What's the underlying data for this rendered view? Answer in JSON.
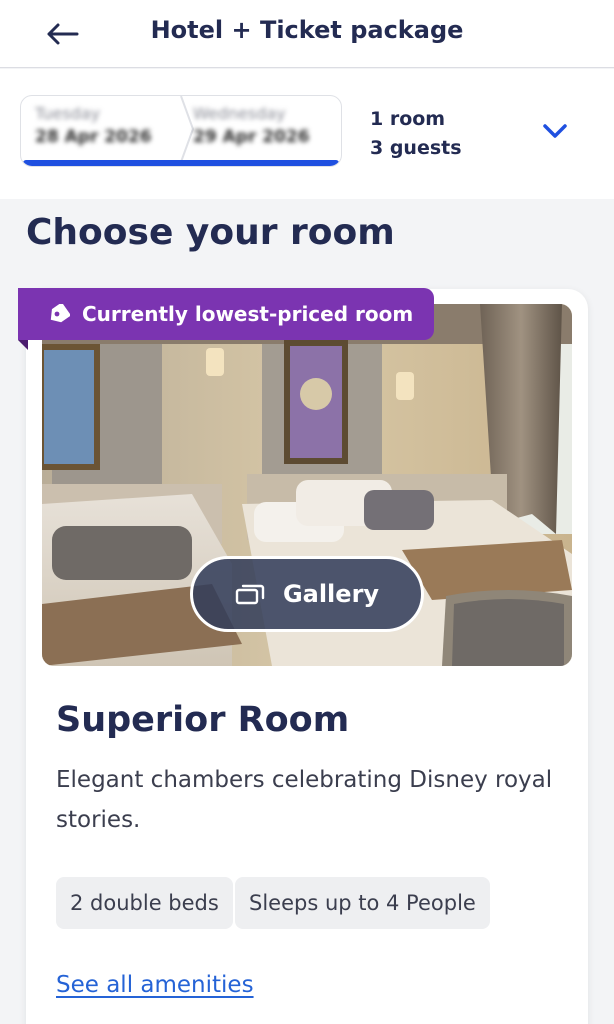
{
  "header": {
    "title": "Hotel + Ticket package",
    "back_icon": "arrow-left-icon"
  },
  "booking": {
    "checkin_day": "Tuesday",
    "checkin_date": "28 Apr 2026",
    "checkout_day": "Wednesday",
    "checkout_date": "29 Apr 2026",
    "rooms": "1 room",
    "guests": "3 guests",
    "expand_icon": "chevron-down-icon"
  },
  "section_title": "Choose your room",
  "room": {
    "badge": "Currently lowest-priced room",
    "badge_icon": "tag-icon",
    "gallery_label": "Gallery",
    "gallery_icon": "gallery-icon",
    "name": "Superior Room",
    "description": "Elegant chambers celebrating Disney royal stories.",
    "features": [
      "2 double beds",
      "Sleeps up to 4 People"
    ],
    "amenities_link": "See all amenities"
  },
  "colors": {
    "brand_navy": "#232b52",
    "accent_blue": "#1f50e0",
    "badge_purple": "#7b34b1",
    "link_blue": "#2563d6"
  }
}
